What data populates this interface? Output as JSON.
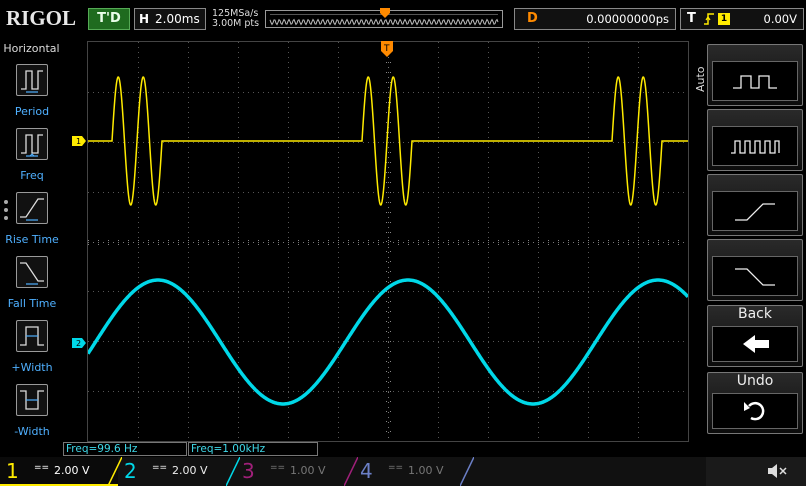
{
  "brand": "RIGOL",
  "colors": {
    "ch1": "#ffeb00",
    "ch2": "#00d8e8",
    "ch3": "#a0207a",
    "ch4": "#6b7fc6",
    "trigger": "#ff8a00",
    "menu_label": "#4fb0ff"
  },
  "topbar": {
    "status": "T'D",
    "timebase_label": "H",
    "timebase_value": "2.00ms",
    "sample_rate": "125MSa/s",
    "memory_depth": "3.00M pts",
    "delay_label": "D",
    "delay_value": "0.00000000ps",
    "trigger_label": "T",
    "trigger_slope_icon": "rising-edge-icon",
    "trigger_source": "1",
    "trigger_level": "0.00V"
  },
  "left_menu": {
    "title": "Horizontal",
    "items": [
      {
        "label": "Period",
        "icon": "period-icon"
      },
      {
        "label": "Freq",
        "icon": "frequency-icon"
      },
      {
        "label": "Rise Time",
        "icon": "rise-time-icon"
      },
      {
        "label": "Fall Time",
        "icon": "fall-time-icon"
      },
      {
        "label": "+Width",
        "icon": "positive-width-icon"
      },
      {
        "label": "-Width",
        "icon": "negative-width-icon"
      }
    ]
  },
  "right_menu": {
    "mode_label": "Auto",
    "buttons": [
      {
        "icon": "single-pulse-icon"
      },
      {
        "icon": "pulse-train-icon"
      },
      {
        "icon": "rising-edge-icon"
      },
      {
        "icon": "falling-edge-icon"
      }
    ],
    "back_label": "Back",
    "back_icon": "left-arrow-icon",
    "undo_label": "Undo",
    "undo_icon": "undo-icon"
  },
  "markers": {
    "ch1": "1",
    "ch2": "2",
    "trigger_pos": "T",
    "trigger_level": "T"
  },
  "measurements": [
    {
      "text": "Freq=99.6 Hz"
    },
    {
      "text": "Freq=1.00kHz"
    }
  ],
  "channels": [
    {
      "num": "1",
      "coupling": "==",
      "scale": "2.00 V"
    },
    {
      "num": "2",
      "coupling": "==",
      "scale": "2.00 V"
    },
    {
      "num": "3",
      "coupling": "==",
      "scale": "1.00 V"
    },
    {
      "num": "4",
      "coupling": "==",
      "scale": "1.00 V"
    }
  ],
  "sound_icon": "speaker-muted-icon"
}
